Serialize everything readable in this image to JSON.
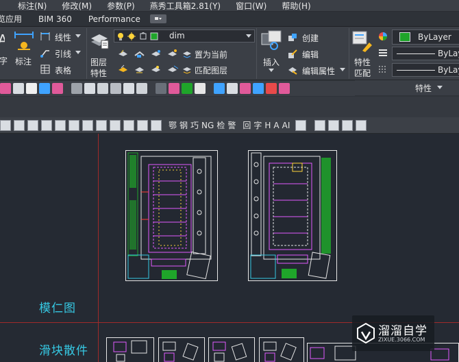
{
  "menubar": {
    "items": [
      "标注(N)",
      "修改(M)",
      "参数(P)",
      "燕秀工具箱2.81(Y)",
      "窗口(W)",
      "帮助(H)"
    ]
  },
  "tabs": {
    "items": [
      "览应用",
      "BIM 360",
      "Performance"
    ]
  },
  "ribbon": {
    "dim_label_left": "字",
    "annotate_label": "标注",
    "linear_label": "线性",
    "leader_label": "引线",
    "table_label": "表格",
    "layer_props_label_1": "图层",
    "layer_props_label_2": "特性",
    "layer_combo_value": "dim",
    "set_current_label": "置为当前",
    "match_layer_label": "匹配图层",
    "insert_label": "插入",
    "create_label": "创建",
    "edit_label": "编辑",
    "edit_attr_label": "编辑属性",
    "match_props_label_1": "特性",
    "match_props_label_2": "匹配",
    "bylayer_value": "ByLayer",
    "linetype_value": "ByLay",
    "lineweight_value": "ByLay",
    "properties_panel_title": "特性"
  },
  "toolbar2": {
    "chars": [
      "鄂",
      "钢",
      "巧",
      "NG",
      "检",
      "警",
      "回",
      "字",
      "H",
      "A",
      "AI"
    ]
  },
  "canvas": {
    "label_mold": "模仁图",
    "label_slider": "滑块散件"
  },
  "watermark": {
    "title": "溜溜自学",
    "url": "ZIXUE.3066.COM"
  },
  "colors": {
    "canvas_bg": "#252a33",
    "accent_cyan": "#36c9e4",
    "boundary_red": "#a12a2a",
    "bylayer_green": "#1fa52a"
  }
}
